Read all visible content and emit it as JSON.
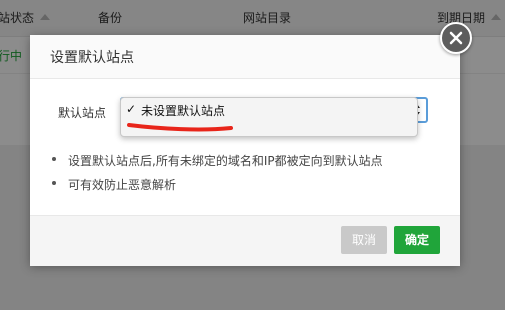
{
  "background": {
    "columns": [
      {
        "label": "站状态",
        "sortable": true
      },
      {
        "label": "备份",
        "sortable": false
      },
      {
        "label": "网站目录",
        "sortable": false
      },
      {
        "label": "到期日期",
        "sortable": true
      }
    ],
    "row_status": "行中"
  },
  "dialog": {
    "title": "设置默认站点",
    "field_label": "默认站点",
    "select": {
      "selected": "未设置默认站点",
      "check_mark": "✓"
    },
    "notes": [
      "设置默认站点后,所有未绑定的域名和IP都被定向到默认站点",
      "可有效防止恶意解析"
    ],
    "cancel_label": "取消",
    "confirm_label": "确定"
  },
  "colors": {
    "accent_green": "#20a53a",
    "select_border": "#5b9dd9",
    "annotation_red": "#e8251a"
  },
  "icons": {
    "close": "close-icon",
    "sort": "sort-up-icon",
    "select_arrows": "select-arrows-icon"
  }
}
